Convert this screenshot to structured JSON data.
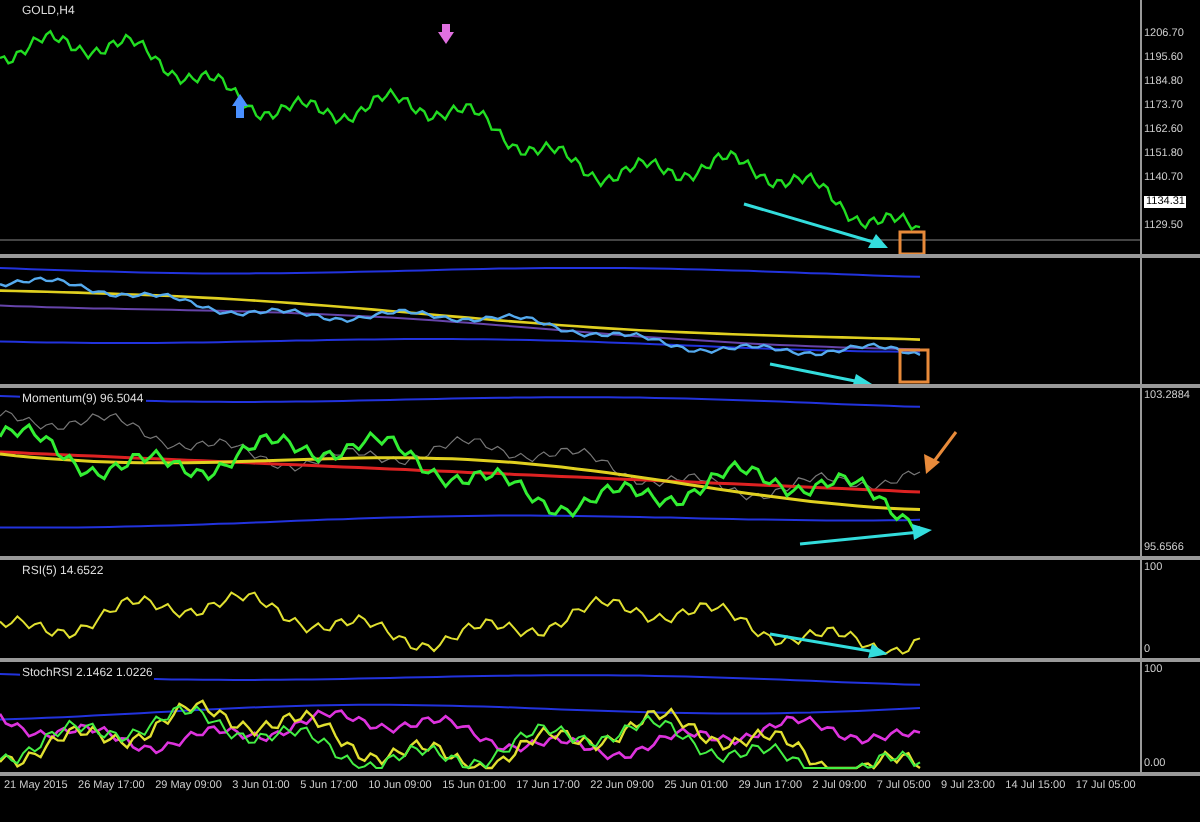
{
  "panes": [
    {
      "kind": "price",
      "label": "GOLD,H4",
      "axis_labels": [
        "1206.70",
        "1195.60",
        "1184.80",
        "1173.70",
        "1162.60",
        "1151.80",
        "1140.70"
      ],
      "current_price": "1134.31",
      "bottom_label": "1129.50"
    },
    {
      "kind": "bands"
    },
    {
      "kind": "momentum",
      "label": "Momentum(9) 96.5044",
      "axis_labels": [
        "103.2884",
        "95.6566"
      ]
    },
    {
      "kind": "rsi",
      "label": "RSI(5) 14.6522",
      "axis_labels": [
        "100",
        "0"
      ]
    },
    {
      "kind": "stoch",
      "label": "StochRSI 2.1462 1.0226",
      "axis_labels": [
        "100",
        "0.00"
      ]
    }
  ],
  "time_axis": [
    "21 May 2015",
    "26 May 17:00",
    "29 May 09:00",
    "3 Jun 01:00",
    "5 Jun 17:00",
    "10 Jun 09:00",
    "15 Jun 01:00",
    "17 Jun 17:00",
    "22 Jun 09:00",
    "25 Jun 01:00",
    "29 Jun 17:00",
    "2 Jul 09:00",
    "7 Jul 05:00",
    "9 Jul 23:00",
    "14 Jul 15:00",
    "17 Jul 05:00"
  ]
}
